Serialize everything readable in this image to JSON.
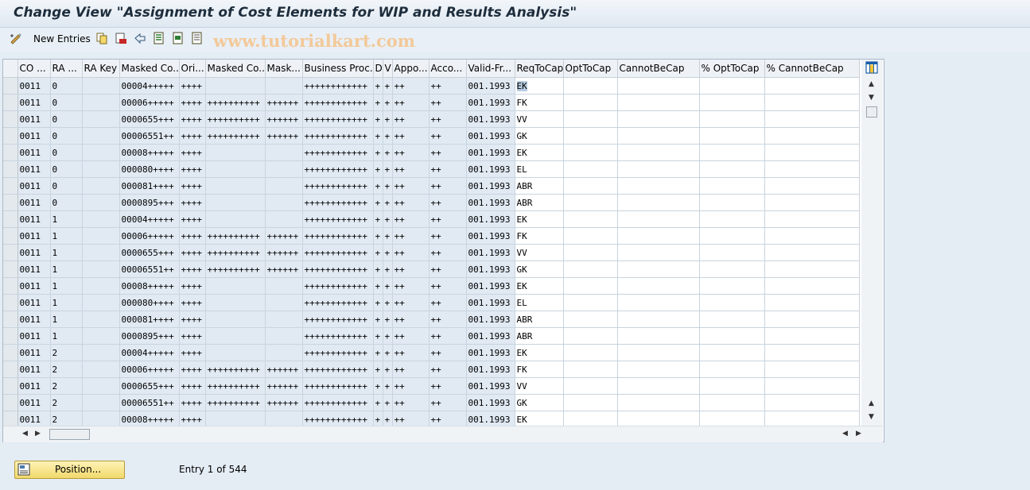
{
  "window": {
    "title": "Change View \"Assignment of Cost Elements for WIP and Results Analysis\""
  },
  "toolbar": {
    "new_entries_label": "New Entries",
    "watermark": "www.tutorialkart.com"
  },
  "table": {
    "columns": [
      "CO ...",
      "RA ...",
      "RA Key",
      "Masked Co...",
      "Ori...",
      "Masked Co...",
      "Mask...",
      "Business Proc.",
      "D",
      "V",
      "Appo...",
      "Acco...",
      "Valid-Fr...",
      "ReqToCap",
      "OptToCap",
      "CannotBeCap",
      "% OptToCap",
      "% CannotBeCap"
    ],
    "rows": [
      [
        "0011",
        "0",
        "",
        "00004+++++",
        "++++",
        "",
        "",
        "++++++++++++",
        "+",
        "+",
        "++",
        "++",
        "001.1993",
        "EK",
        "",
        "",
        "",
        ""
      ],
      [
        "0011",
        "0",
        "",
        "00006+++++",
        "++++",
        "++++++++++",
        "++++++",
        "++++++++++++",
        "+",
        "+",
        "++",
        "++",
        "001.1993",
        "FK",
        "",
        "",
        "",
        ""
      ],
      [
        "0011",
        "0",
        "",
        "0000655+++",
        "++++",
        "++++++++++",
        "++++++",
        "++++++++++++",
        "+",
        "+",
        "++",
        "++",
        "001.1993",
        "VV",
        "",
        "",
        "",
        ""
      ],
      [
        "0011",
        "0",
        "",
        "00006551++",
        "++++",
        "++++++++++",
        "++++++",
        "++++++++++++",
        "+",
        "+",
        "++",
        "++",
        "001.1993",
        "GK",
        "",
        "",
        "",
        ""
      ],
      [
        "0011",
        "0",
        "",
        "00008+++++",
        "++++",
        "",
        "",
        "++++++++++++",
        "+",
        "+",
        "++",
        "++",
        "001.1993",
        "EK",
        "",
        "",
        "",
        ""
      ],
      [
        "0011",
        "0",
        "",
        "000080++++",
        "++++",
        "",
        "",
        "++++++++++++",
        "+",
        "+",
        "++",
        "++",
        "001.1993",
        "EL",
        "",
        "",
        "",
        ""
      ],
      [
        "0011",
        "0",
        "",
        "000081++++",
        "++++",
        "",
        "",
        "++++++++++++",
        "+",
        "+",
        "++",
        "++",
        "001.1993",
        "ABR",
        "",
        "",
        "",
        ""
      ],
      [
        "0011",
        "0",
        "",
        "0000895+++",
        "++++",
        "",
        "",
        "++++++++++++",
        "+",
        "+",
        "++",
        "++",
        "001.1993",
        "ABR",
        "",
        "",
        "",
        ""
      ],
      [
        "0011",
        "1",
        "",
        "00004+++++",
        "++++",
        "",
        "",
        "++++++++++++",
        "+",
        "+",
        "++",
        "++",
        "001.1993",
        "EK",
        "",
        "",
        "",
        ""
      ],
      [
        "0011",
        "1",
        "",
        "00006+++++",
        "++++",
        "++++++++++",
        "++++++",
        "++++++++++++",
        "+",
        "+",
        "++",
        "++",
        "001.1993",
        "FK",
        "",
        "",
        "",
        ""
      ],
      [
        "0011",
        "1",
        "",
        "0000655+++",
        "++++",
        "++++++++++",
        "++++++",
        "++++++++++++",
        "+",
        "+",
        "++",
        "++",
        "001.1993",
        "VV",
        "",
        "",
        "",
        ""
      ],
      [
        "0011",
        "1",
        "",
        "00006551++",
        "++++",
        "++++++++++",
        "++++++",
        "++++++++++++",
        "+",
        "+",
        "++",
        "++",
        "001.1993",
        "GK",
        "",
        "",
        "",
        ""
      ],
      [
        "0011",
        "1",
        "",
        "00008+++++",
        "++++",
        "",
        "",
        "++++++++++++",
        "+",
        "+",
        "++",
        "++",
        "001.1993",
        "EK",
        "",
        "",
        "",
        ""
      ],
      [
        "0011",
        "1",
        "",
        "000080++++",
        "++++",
        "",
        "",
        "++++++++++++",
        "+",
        "+",
        "++",
        "++",
        "001.1993",
        "EL",
        "",
        "",
        "",
        ""
      ],
      [
        "0011",
        "1",
        "",
        "000081++++",
        "++++",
        "",
        "",
        "++++++++++++",
        "+",
        "+",
        "++",
        "++",
        "001.1993",
        "ABR",
        "",
        "",
        "",
        ""
      ],
      [
        "0011",
        "1",
        "",
        "0000895+++",
        "++++",
        "",
        "",
        "++++++++++++",
        "+",
        "+",
        "++",
        "++",
        "001.1993",
        "ABR",
        "",
        "",
        "",
        ""
      ],
      [
        "0011",
        "2",
        "",
        "00004+++++",
        "++++",
        "",
        "",
        "++++++++++++",
        "+",
        "+",
        "++",
        "++",
        "001.1993",
        "EK",
        "",
        "",
        "",
        ""
      ],
      [
        "0011",
        "2",
        "",
        "00006+++++",
        "++++",
        "++++++++++",
        "++++++",
        "++++++++++++",
        "+",
        "+",
        "++",
        "++",
        "001.1993",
        "FK",
        "",
        "",
        "",
        ""
      ],
      [
        "0011",
        "2",
        "",
        "0000655+++",
        "++++",
        "++++++++++",
        "++++++",
        "++++++++++++",
        "+",
        "+",
        "++",
        "++",
        "001.1993",
        "VV",
        "",
        "",
        "",
        ""
      ],
      [
        "0011",
        "2",
        "",
        "00006551++",
        "++++",
        "++++++++++",
        "++++++",
        "++++++++++++",
        "+",
        "+",
        "++",
        "++",
        "001.1993",
        "GK",
        "",
        "",
        "",
        ""
      ],
      [
        "0011",
        "2",
        "",
        "00008+++++",
        "++++",
        "",
        "",
        "++++++++++++",
        "+",
        "+",
        "++",
        "++",
        "001.1993",
        "EK",
        "",
        "",
        "",
        ""
      ]
    ]
  },
  "footer": {
    "position_label": "Position...",
    "entry_text": "Entry 1 of 544"
  }
}
